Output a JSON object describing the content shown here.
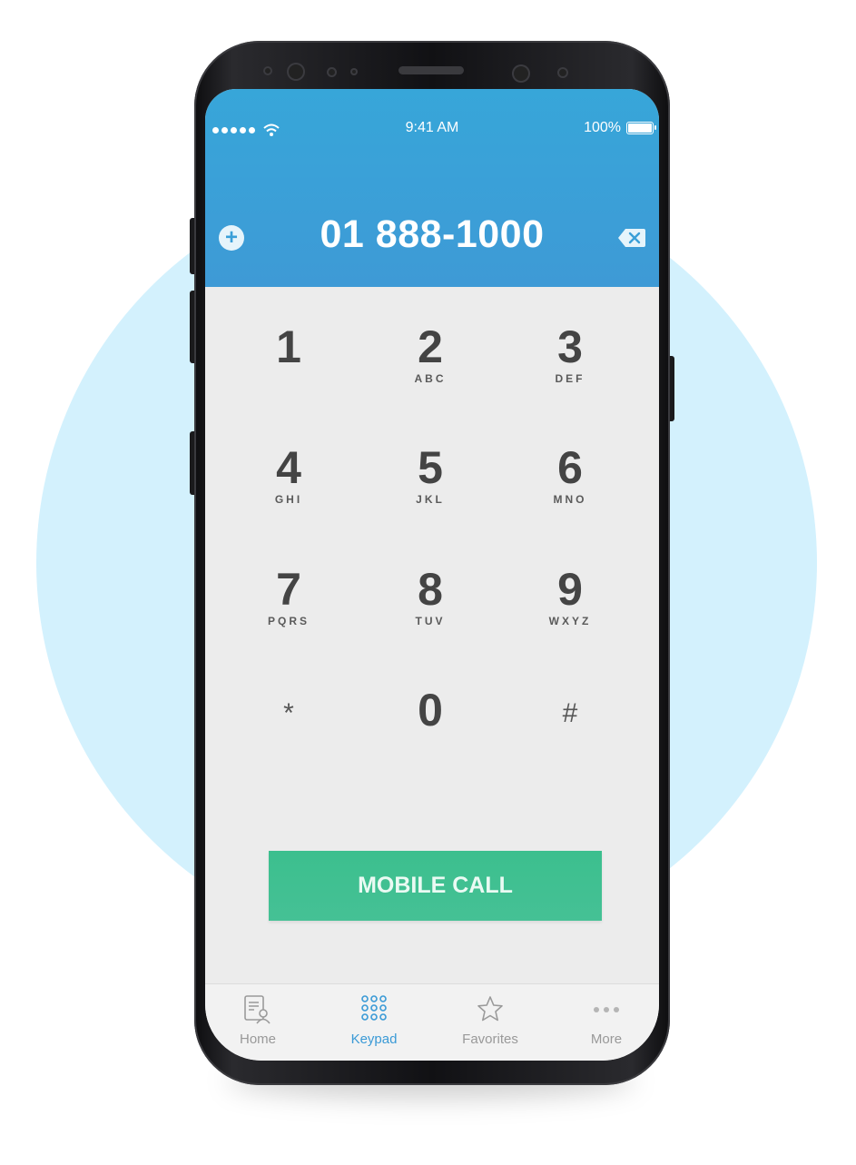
{
  "status_bar": {
    "time": "9:41 AM",
    "battery": "100%",
    "icons": [
      "signal-dots-icon",
      "wifi-icon",
      "battery-icon"
    ]
  },
  "dialer": {
    "number": "01 888-1000",
    "add_icon": "plus-circle-icon",
    "delete_icon": "backspace-icon"
  },
  "keypad": {
    "keys": [
      {
        "digit": "1",
        "letters": ""
      },
      {
        "digit": "2",
        "letters": "ABC"
      },
      {
        "digit": "3",
        "letters": "DEF"
      },
      {
        "digit": "4",
        "letters": "GHI"
      },
      {
        "digit": "5",
        "letters": "JKL"
      },
      {
        "digit": "6",
        "letters": "MNO"
      },
      {
        "digit": "7",
        "letters": "PQRS"
      },
      {
        "digit": "8",
        "letters": "TUV"
      },
      {
        "digit": "9",
        "letters": "WXYZ"
      },
      {
        "digit": "*",
        "letters": ""
      },
      {
        "digit": "0",
        "letters": ""
      },
      {
        "digit": "#",
        "letters": ""
      }
    ]
  },
  "call_button": {
    "label": "MOBILE CALL"
  },
  "tabs": [
    {
      "label": "Home",
      "icon": "contacts-icon",
      "active": false
    },
    {
      "label": "Keypad",
      "icon": "keypad-grid-icon",
      "active": true
    },
    {
      "label": "Favorites",
      "icon": "star-icon",
      "active": false
    },
    {
      "label": "More",
      "icon": "more-dots-icon",
      "active": false
    }
  ],
  "colors": {
    "header": "#3ea2d8",
    "call_button": "#3fbf8f",
    "active_tab": "#3a9ad6",
    "background_circle": "#d3f1fd"
  }
}
